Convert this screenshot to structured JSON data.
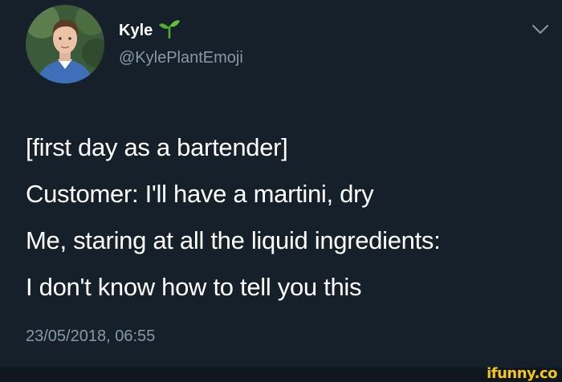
{
  "tweet": {
    "author": {
      "display_name": "Kyle",
      "emoji_icon": "seedling-icon",
      "handle": "@KylePlantEmoji"
    },
    "menu_icon": "chevron-down-icon",
    "text_lines": [
      "[first day as a bartender]",
      "Customer: I'll have a martini, dry",
      "Me, staring at all the liquid ingredients:",
      "I don't know how to tell you this"
    ],
    "timestamp": "23/05/2018, 06:55"
  },
  "watermark": {
    "text": "ifunny.co"
  },
  "colors": {
    "background": "#15202b",
    "text_primary": "#ffffff",
    "text_secondary": "#8899a6",
    "emoji_green": "#4caf2e",
    "watermark": "#f5c518"
  }
}
